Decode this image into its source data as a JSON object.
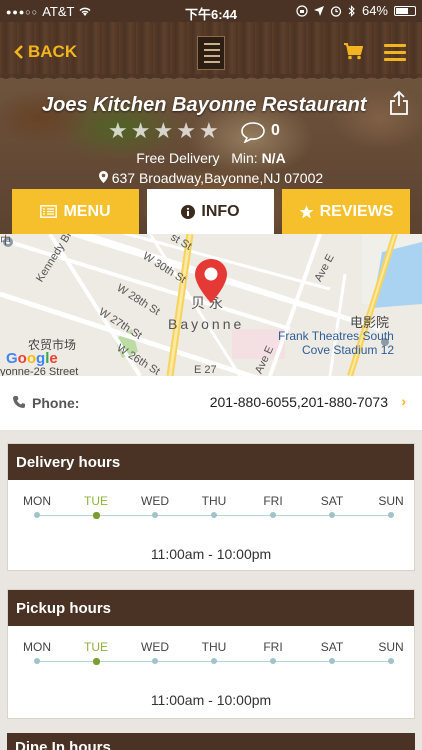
{
  "status_bar": {
    "carrier": "AT&T",
    "time": "下午6:44",
    "battery": "64%",
    "battery_level": 0.64
  },
  "nav": {
    "back_label": "BACK"
  },
  "restaurant": {
    "name": "Joes Kitchen Bayonne Restaurant",
    "rating": 0,
    "rating_max": 5,
    "review_count": "0",
    "delivery_label": "Free Delivery",
    "min_label": "Min:",
    "min_value": "N/A",
    "address": "637 Broadway,Bayonne,NJ 07002"
  },
  "tabs": [
    {
      "label": "MENU",
      "icon": "menu-list-icon",
      "active": false
    },
    {
      "label": "INFO",
      "icon": "info-icon",
      "active": true
    },
    {
      "label": "REVIEWS",
      "icon": "star-icon",
      "active": false
    }
  ],
  "map": {
    "labels": {
      "w30": "W 30th St",
      "w28": "W 28th St",
      "w27": "W 27th St",
      "w26": "W 26th St",
      "kennedy": "Kennedy Blvd",
      "ave_e_top": "Ave E",
      "ave_e_bottom": "Ave E",
      "e27": "E 27",
      "st_top": "st St",
      "cn_market": "农贸市场",
      "street26": "yonne-26 Street",
      "cinema_cn": "电影院",
      "frank_line1": "Frank Theatres South",
      "frank_line2": "Cove Stadium 12",
      "city_cn": "贝永",
      "city": "Bayonne",
      "top_left": "中",
      "google": "Google"
    }
  },
  "phone": {
    "label": "Phone:",
    "value": "201-880-6055,201-880-7073"
  },
  "delivery_hours": {
    "title": "Delivery hours",
    "days": [
      "MON",
      "TUE",
      "WED",
      "THU",
      "FRI",
      "SAT",
      "SUN"
    ],
    "today_index": 1,
    "hours": "11:00am - 10:00pm"
  },
  "pickup_hours": {
    "title": "Pickup hours",
    "days": [
      "MON",
      "TUE",
      "WED",
      "THU",
      "FRI",
      "SAT",
      "SUN"
    ],
    "today_index": 1,
    "hours": "11:00am - 10:00pm"
  },
  "next_section": {
    "title": "Dine In hours"
  },
  "colors": {
    "brand_brown": "#4a3324",
    "accent_yellow": "#f5c02b",
    "today_green": "#8db33b",
    "pin_red": "#e53935"
  }
}
